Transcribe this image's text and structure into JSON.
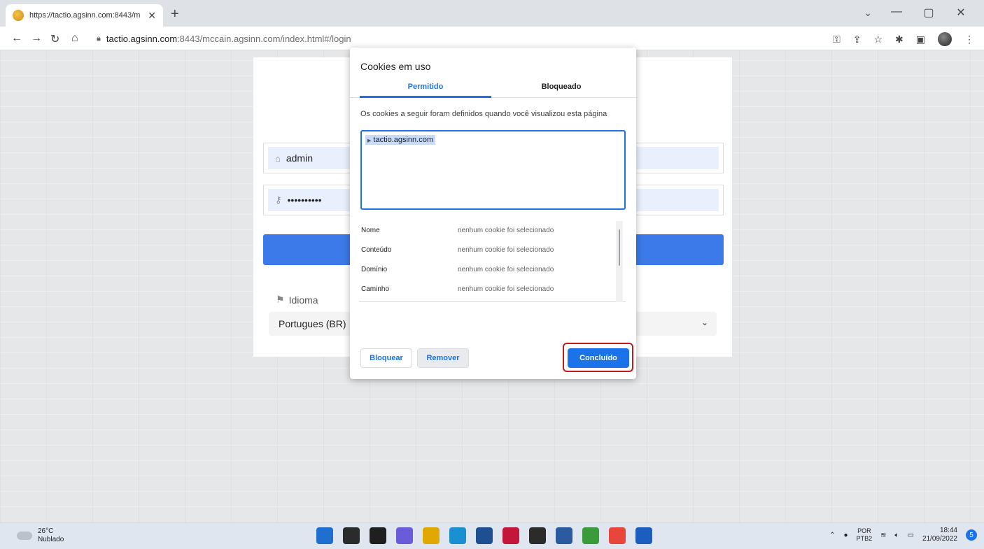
{
  "browser": {
    "tab_title": "https://tactio.agsinn.com:8443/m",
    "tab_close": "✕",
    "new_tab": "+",
    "url_host": "tactio.agsinn.com",
    "url_rest": ":8443/mccain.agsinn.com/index.html#/login",
    "window_controls": [
      "⌄",
      "—",
      "▢",
      "✕"
    ]
  },
  "login": {
    "username_value": "admin",
    "password_value": "••••••••••",
    "language_label": "Idioma",
    "language_selected": "Portugues (BR)"
  },
  "cookie_popup": {
    "title": "Cookies em uso",
    "tabs": [
      {
        "label": "Permitido",
        "active": true
      },
      {
        "label": "Bloqueado",
        "active": false
      }
    ],
    "description": "Os cookies a seguir foram definidos quando você visualizou esta página",
    "tree_items": [
      "tactio.agsinn.com"
    ],
    "details": [
      {
        "key": "Nome",
        "value": "nenhum cookie foi selecionado"
      },
      {
        "key": "Conteúdo",
        "value": "nenhum cookie foi selecionado"
      },
      {
        "key": "Domínio",
        "value": "nenhum cookie foi selecionado"
      },
      {
        "key": "Caminho",
        "value": "nenhum cookie foi selecionado"
      }
    ],
    "buttons": {
      "block": "Bloquear",
      "remove": "Remover",
      "done": "Concluído"
    }
  },
  "taskbar": {
    "temperature": "26°C",
    "weather": "Nublado",
    "lang_top": "POR",
    "lang_bottom": "PTB2",
    "time": "18:44",
    "date": "21/09/2022",
    "notifications": "5",
    "app_colors": [
      "#1f6fd1",
      "#2b2b2b",
      "#1f1f1f",
      "#6a5cd8",
      "#e0a800",
      "#1a8fd1",
      "#1d4f91",
      "#c4153b",
      "#2b2b2b",
      "#2c5aa0",
      "#3a9b3a",
      "#e8453c",
      "#1b5ebf"
    ]
  }
}
